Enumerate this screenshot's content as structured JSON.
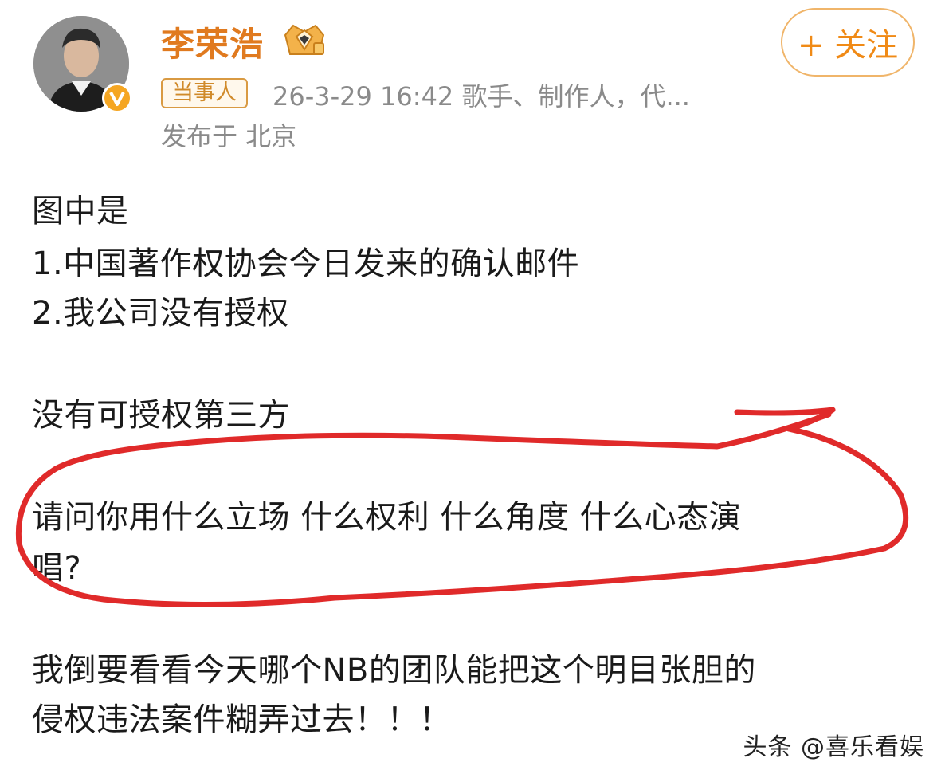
{
  "header": {
    "username": "李荣浩",
    "badge": "当事人",
    "meta": "26-3-29 16:42   歌手、制作人，代...",
    "location": "发布于 北京",
    "follow_label": "+ 关注"
  },
  "post": {
    "lines": [
      "图中是",
      "1.中国著作权协会今日发来的确认邮件",
      "2.我公司没有授权",
      "没有可授权第三方",
      "请问你用什么立场 什么权利 什么角度 什么心态演",
      "唱?",
      "我倒要看看今天哪个NB的团队能把这个明目张胆的",
      "侵权违法案件糊弄过去！！！"
    ]
  },
  "annotation": {
    "color": "#e02a2a"
  },
  "watermark": "头条 @喜乐看娱",
  "colors": {
    "accent": "#e07a1f",
    "follow": "#f08a16",
    "meta": "#8a8a8a",
    "verified": "#f5a623"
  },
  "icons": {
    "crown": "crown-gift-icon",
    "verified": "verified-v-icon"
  }
}
